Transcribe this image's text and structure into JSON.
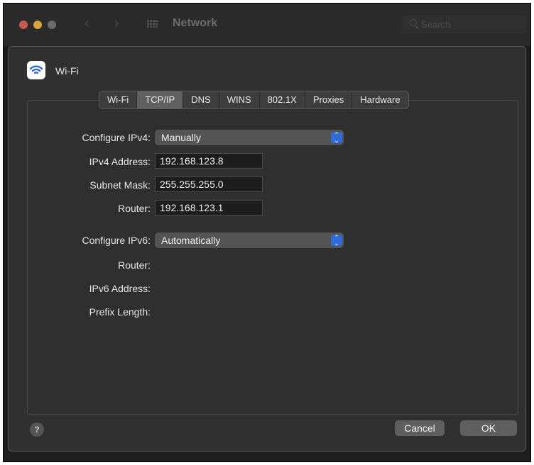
{
  "window": {
    "title": "Network",
    "search_placeholder": "Search",
    "back_arrow": "‹",
    "forward_arrow": "›"
  },
  "service": {
    "name": "Wi-Fi",
    "icon": "wifi-icon"
  },
  "tabs": [
    {
      "label": "Wi-Fi",
      "selected": false
    },
    {
      "label": "TCP/IP",
      "selected": true
    },
    {
      "label": "DNS",
      "selected": false
    },
    {
      "label": "WINS",
      "selected": false
    },
    {
      "label": "802.1X",
      "selected": false
    },
    {
      "label": "Proxies",
      "selected": false
    },
    {
      "label": "Hardware",
      "selected": false
    }
  ],
  "ipv4": {
    "configure_label": "Configure IPv4:",
    "configure_value": "Manually",
    "address_label": "IPv4 Address:",
    "address_value": "192.168.123.8",
    "subnet_label": "Subnet Mask:",
    "subnet_value": "255.255.255.0",
    "router_label": "Router:",
    "router_value": "192.168.123.1"
  },
  "ipv6": {
    "configure_label": "Configure IPv6:",
    "configure_value": "Automatically",
    "router_label": "Router:",
    "address_label": "IPv6 Address:",
    "prefix_label": "Prefix Length:"
  },
  "footer": {
    "help_label": "?",
    "cancel_label": "Cancel",
    "ok_label": "OK"
  },
  "colors": {
    "window_bg": "#1e1e1e",
    "sheet_bg": "#303030",
    "accent": "#2f6bd9",
    "selected_tab": "#606060"
  }
}
